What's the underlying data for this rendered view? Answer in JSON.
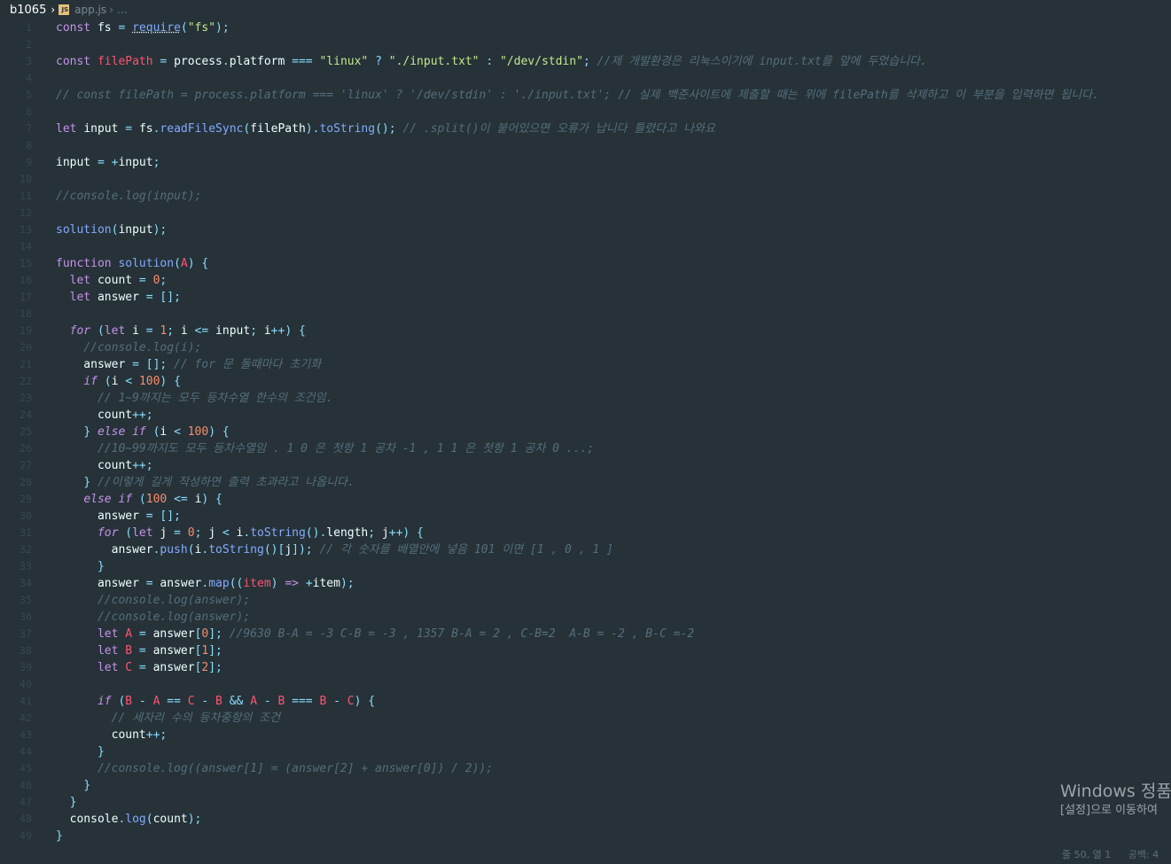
{
  "breadcrumb": {
    "folder": "b1065",
    "file": "app.js",
    "more": "..."
  },
  "code_lines": [
    [
      [
        "kw",
        "const "
      ],
      [
        "var",
        "fs"
      ],
      [
        "op",
        " = "
      ],
      [
        "fn req",
        "require"
      ],
      [
        "pun",
        "("
      ],
      [
        "str",
        "\"fs\""
      ],
      [
        "pun",
        ");"
      ]
    ],
    [],
    [
      [
        "kw",
        "const "
      ],
      [
        "prm",
        "filePath"
      ],
      [
        "op",
        " = "
      ],
      [
        "var",
        "process"
      ],
      [
        "pun",
        "."
      ],
      [
        "var",
        "platform"
      ],
      [
        "op",
        " === "
      ],
      [
        "str",
        "\"linux\""
      ],
      [
        "op",
        " ? "
      ],
      [
        "str",
        "\"./input.txt\""
      ],
      [
        "op",
        " : "
      ],
      [
        "str",
        "\"/dev/stdin\""
      ],
      [
        "pun",
        "; "
      ],
      [
        "cm",
        "//제 개발환경은 리눅스이기에 input.txt를 앞에 두었습니다."
      ]
    ],
    [],
    [
      [
        "cm",
        "// const filePath = process.platform === 'linux' ? '/dev/stdin' : './input.txt'; // 실제 백준사이트에 제출할 때는 위에 filePath를 삭제하고 이 부분을 입력하면 됩니다."
      ]
    ],
    [],
    [
      [
        "kw",
        "let "
      ],
      [
        "var",
        "input"
      ],
      [
        "op",
        " = "
      ],
      [
        "var",
        "fs"
      ],
      [
        "pun",
        "."
      ],
      [
        "fn",
        "readFileSync"
      ],
      [
        "pun",
        "("
      ],
      [
        "var",
        "filePath"
      ],
      [
        "pun",
        ")."
      ],
      [
        "fn",
        "toString"
      ],
      [
        "pun",
        "(); "
      ],
      [
        "cm",
        "// .split()이 붙어있으면 오류가 납니다 틀렸다고 나와요"
      ]
    ],
    [],
    [
      [
        "var",
        "input"
      ],
      [
        "op",
        " = +"
      ],
      [
        "var",
        "input"
      ],
      [
        "pun",
        ";"
      ]
    ],
    [],
    [
      [
        "cm",
        "//console.log(input);"
      ]
    ],
    [],
    [
      [
        "fn",
        "solution"
      ],
      [
        "pun",
        "("
      ],
      [
        "var",
        "input"
      ],
      [
        "pun",
        ");"
      ]
    ],
    [],
    [
      [
        "kw",
        "function "
      ],
      [
        "fn",
        "solution"
      ],
      [
        "pun",
        "("
      ],
      [
        "prm",
        "A"
      ],
      [
        "pun",
        ") {"
      ]
    ],
    [
      [
        "var",
        "  "
      ],
      [
        "kw",
        "let "
      ],
      [
        "var",
        "count"
      ],
      [
        "op",
        " = "
      ],
      [
        "num",
        "0"
      ],
      [
        "pun",
        ";"
      ]
    ],
    [
      [
        "var",
        "  "
      ],
      [
        "kw",
        "let "
      ],
      [
        "var",
        "answer"
      ],
      [
        "op",
        " = "
      ],
      [
        "pun",
        "[];"
      ]
    ],
    [],
    [
      [
        "var",
        "  "
      ],
      [
        "kwi",
        "for"
      ],
      [
        "pun",
        " ("
      ],
      [
        "kw",
        "let "
      ],
      [
        "var",
        "i"
      ],
      [
        "op",
        " = "
      ],
      [
        "num",
        "1"
      ],
      [
        "pun",
        "; "
      ],
      [
        "var",
        "i"
      ],
      [
        "op",
        " <= "
      ],
      [
        "var",
        "input"
      ],
      [
        "pun",
        "; "
      ],
      [
        "var",
        "i"
      ],
      [
        "op",
        "++"
      ],
      [
        "pun",
        ") {"
      ]
    ],
    [
      [
        "var",
        "    "
      ],
      [
        "cm",
        "//console.log(i);"
      ]
    ],
    [
      [
        "var",
        "    answer"
      ],
      [
        "op",
        " = "
      ],
      [
        "pun",
        "[]; "
      ],
      [
        "cm",
        "// for 문 돌때마다 초기화"
      ]
    ],
    [
      [
        "var",
        "    "
      ],
      [
        "kwi",
        "if"
      ],
      [
        "pun",
        " ("
      ],
      [
        "var",
        "i"
      ],
      [
        "op",
        " < "
      ],
      [
        "num",
        "100"
      ],
      [
        "pun",
        ") {"
      ]
    ],
    [
      [
        "var",
        "      "
      ],
      [
        "cm",
        "// 1~9까지는 모두 등차수열 한수의 조건임."
      ]
    ],
    [
      [
        "var",
        "      count"
      ],
      [
        "op",
        "++"
      ],
      [
        "pun",
        ";"
      ]
    ],
    [
      [
        "var",
        "    "
      ],
      [
        "pun",
        "} "
      ],
      [
        "kwi",
        "else if"
      ],
      [
        "pun",
        " ("
      ],
      [
        "var",
        "i"
      ],
      [
        "op",
        " < "
      ],
      [
        "num",
        "100"
      ],
      [
        "pun",
        ") {"
      ]
    ],
    [
      [
        "var",
        "      "
      ],
      [
        "cm",
        "//10~99까지도 모두 등차수열임 . 1 0 은 첫항 1 공차 -1 , 1 1 은 첫항 1 공차 0 ...;"
      ]
    ],
    [
      [
        "var",
        "      count"
      ],
      [
        "op",
        "++"
      ],
      [
        "pun",
        ";"
      ]
    ],
    [
      [
        "var",
        "    "
      ],
      [
        "pun",
        "} "
      ],
      [
        "cm",
        "//이렇게 길게 작성하면 출력 초과라고 나옵니다."
      ]
    ],
    [
      [
        "var",
        "    "
      ],
      [
        "kwi",
        "else if"
      ],
      [
        "pun",
        " ("
      ],
      [
        "num",
        "100"
      ],
      [
        "op",
        " <= "
      ],
      [
        "var",
        "i"
      ],
      [
        "pun",
        ") {"
      ]
    ],
    [
      [
        "var",
        "      answer"
      ],
      [
        "op",
        " = "
      ],
      [
        "pun",
        "[];"
      ]
    ],
    [
      [
        "var",
        "      "
      ],
      [
        "kwi",
        "for"
      ],
      [
        "pun",
        " ("
      ],
      [
        "kw",
        "let "
      ],
      [
        "var",
        "j"
      ],
      [
        "op",
        " = "
      ],
      [
        "num",
        "0"
      ],
      [
        "pun",
        "; "
      ],
      [
        "var",
        "j"
      ],
      [
        "op",
        " < "
      ],
      [
        "var",
        "i"
      ],
      [
        "pun",
        "."
      ],
      [
        "fn",
        "toString"
      ],
      [
        "pun",
        "()."
      ],
      [
        "var",
        "length"
      ],
      [
        "pun",
        "; "
      ],
      [
        "var",
        "j"
      ],
      [
        "op",
        "++"
      ],
      [
        "pun",
        ") {"
      ]
    ],
    [
      [
        "var",
        "        answer"
      ],
      [
        "pun",
        "."
      ],
      [
        "fn",
        "push"
      ],
      [
        "pun",
        "("
      ],
      [
        "var",
        "i"
      ],
      [
        "pun",
        "."
      ],
      [
        "fn",
        "toString"
      ],
      [
        "pun",
        "()["
      ],
      [
        "var",
        "j"
      ],
      [
        "pun",
        "]); "
      ],
      [
        "cm",
        "// 각 숫자를 배열안에 넣음 101 이면 [1 , 0 , 1 ]"
      ]
    ],
    [
      [
        "var",
        "      "
      ],
      [
        "pun",
        "}"
      ]
    ],
    [
      [
        "var",
        "      answer"
      ],
      [
        "op",
        " = "
      ],
      [
        "var",
        "answer"
      ],
      [
        "pun",
        "."
      ],
      [
        "fn",
        "map"
      ],
      [
        "pun",
        "(("
      ],
      [
        "prm",
        "item"
      ],
      [
        "pun",
        ") "
      ],
      [
        "kw",
        "=>"
      ],
      [
        "op",
        " +"
      ],
      [
        "var",
        "item"
      ],
      [
        "pun",
        ");"
      ]
    ],
    [
      [
        "var",
        "      "
      ],
      [
        "cm",
        "//console.log(answer);"
      ]
    ],
    [
      [
        "var",
        "      "
      ],
      [
        "cm",
        "//console.log(answer);"
      ]
    ],
    [
      [
        "var",
        "      "
      ],
      [
        "kw",
        "let "
      ],
      [
        "prm",
        "A"
      ],
      [
        "op",
        " = "
      ],
      [
        "var",
        "answer"
      ],
      [
        "pun",
        "["
      ],
      [
        "num",
        "0"
      ],
      [
        "pun",
        "]; "
      ],
      [
        "cm",
        "//9630 B-A = -3 C-B = -3 , 1357 B-A = 2 , C-B=2  A-B = -2 , B-C =-2"
      ]
    ],
    [
      [
        "var",
        "      "
      ],
      [
        "kw",
        "let "
      ],
      [
        "prm",
        "B"
      ],
      [
        "op",
        " = "
      ],
      [
        "var",
        "answer"
      ],
      [
        "pun",
        "["
      ],
      [
        "num",
        "1"
      ],
      [
        "pun",
        "];"
      ]
    ],
    [
      [
        "var",
        "      "
      ],
      [
        "kw",
        "let "
      ],
      [
        "prm",
        "C"
      ],
      [
        "op",
        " = "
      ],
      [
        "var",
        "answer"
      ],
      [
        "pun",
        "["
      ],
      [
        "num",
        "2"
      ],
      [
        "pun",
        "];"
      ]
    ],
    [],
    [
      [
        "var",
        "      "
      ],
      [
        "kwi",
        "if"
      ],
      [
        "pun",
        " ("
      ],
      [
        "prm",
        "B"
      ],
      [
        "op",
        " - "
      ],
      [
        "prm",
        "A"
      ],
      [
        "op",
        " == "
      ],
      [
        "prm",
        "C"
      ],
      [
        "op",
        " - "
      ],
      [
        "prm",
        "B"
      ],
      [
        "op",
        " && "
      ],
      [
        "prm",
        "A"
      ],
      [
        "op",
        " - "
      ],
      [
        "prm",
        "B"
      ],
      [
        "op",
        " === "
      ],
      [
        "prm",
        "B"
      ],
      [
        "op",
        " - "
      ],
      [
        "prm",
        "C"
      ],
      [
        "pun",
        ") {"
      ]
    ],
    [
      [
        "var",
        "        "
      ],
      [
        "cm",
        "// 세자리 수의 등차중항의 조건"
      ]
    ],
    [
      [
        "var",
        "        count"
      ],
      [
        "op",
        "++"
      ],
      [
        "pun",
        ";"
      ]
    ],
    [
      [
        "var",
        "      "
      ],
      [
        "pun",
        "}"
      ]
    ],
    [
      [
        "var",
        "      "
      ],
      [
        "cm",
        "//console.log((answer[1] = (answer[2] + answer[0]) / 2));"
      ]
    ],
    [
      [
        "var",
        "    "
      ],
      [
        "pun",
        "}"
      ]
    ],
    [
      [
        "var",
        "  "
      ],
      [
        "pun",
        "}"
      ]
    ],
    [
      [
        "var",
        "  console"
      ],
      [
        "pun",
        "."
      ],
      [
        "fn",
        "log"
      ],
      [
        "pun",
        "("
      ],
      [
        "var",
        "count"
      ],
      [
        "pun",
        ");"
      ]
    ],
    [
      [
        "pun",
        "}"
      ]
    ]
  ],
  "watermark": {
    "title": "Windows 정품",
    "subtitle": "[설정]으로 이동하여"
  },
  "status_bar": {
    "position": "줄 50, 열 1",
    "spaces": "공백: 4"
  },
  "colors": {
    "background": "#263238",
    "keyword": "#C792EA",
    "function": "#82AAFF",
    "string": "#C3E88D",
    "number": "#F78C6C",
    "operator": "#89DDFF",
    "parameter": "#FF5370",
    "comment": "#546E7A",
    "line_number": "#37474F"
  }
}
